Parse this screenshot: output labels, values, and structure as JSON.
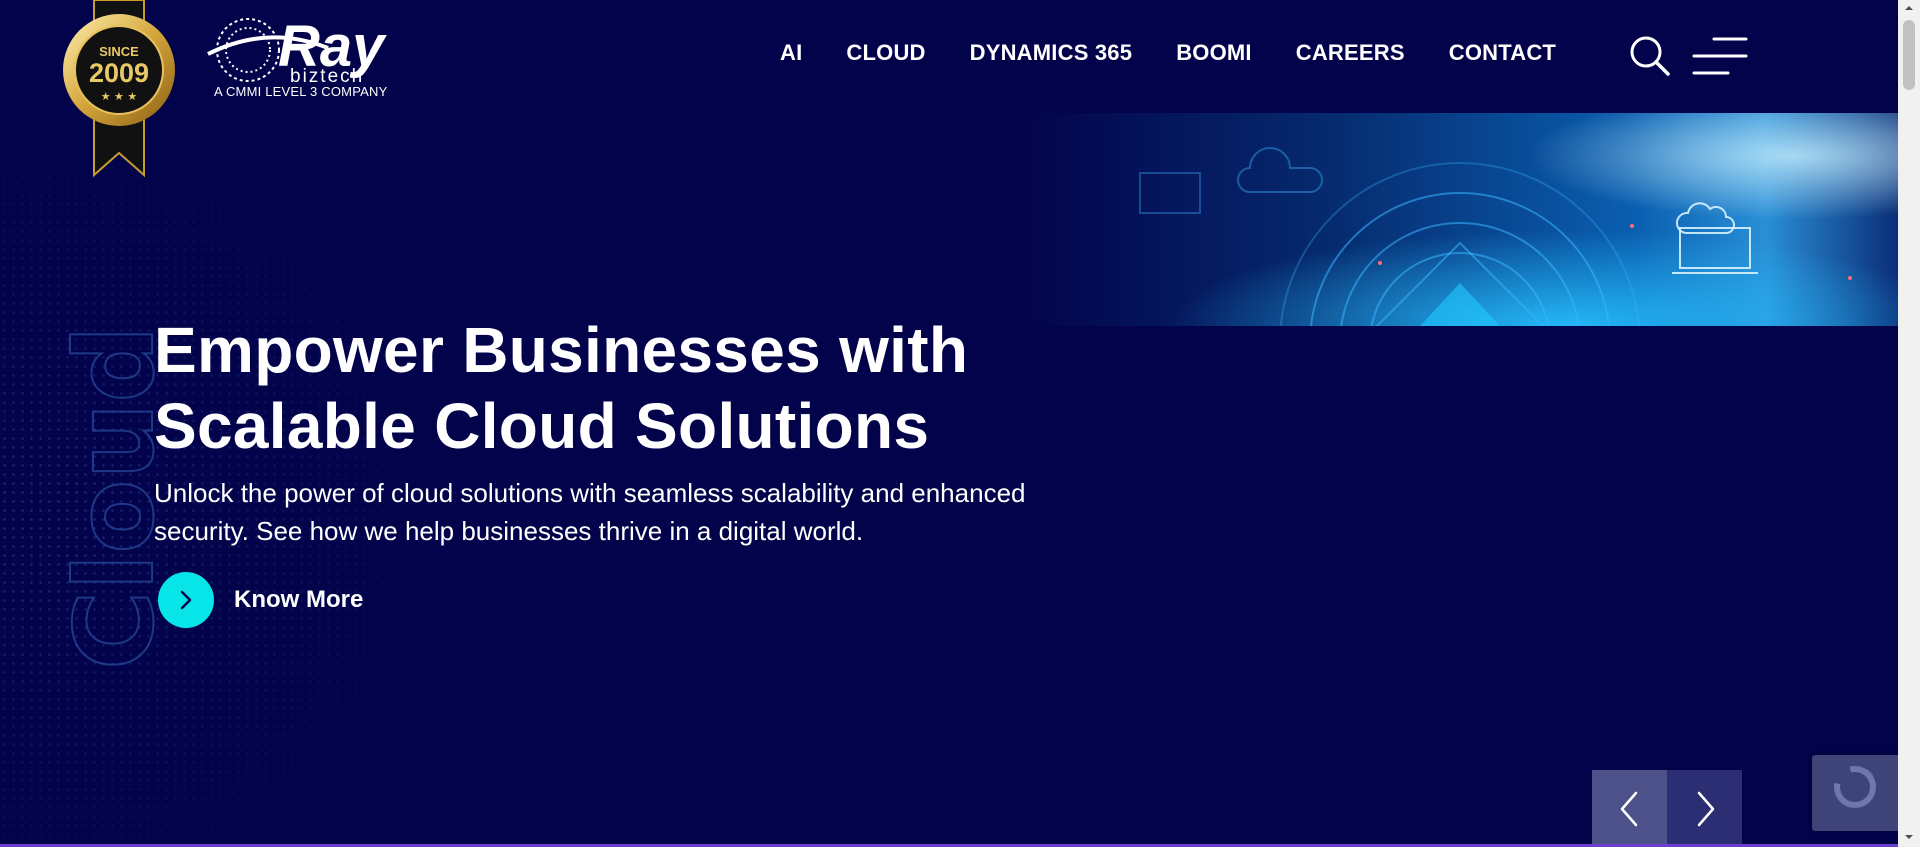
{
  "brand": {
    "badge_since": "SINCE",
    "badge_year": "2009",
    "logo_word": "Ray",
    "logo_sub": "biztech",
    "tagline": "A CMMI LEVEL 3 COMPANY"
  },
  "nav": {
    "items": [
      {
        "label": "AI"
      },
      {
        "label": "CLOUD"
      },
      {
        "label": "DYNAMICS 365"
      },
      {
        "label": "BOOMI"
      },
      {
        "label": "CAREERS"
      },
      {
        "label": "CONTACT"
      }
    ]
  },
  "hero": {
    "vertical_word": "Cloud",
    "title_line1": "Empower Businesses with",
    "title_line2": "Scalable Cloud Solutions",
    "subtitle_line1": "Unlock the power of cloud solutions with seamless scalability and enhanced",
    "subtitle_line2": "security. See how we help businesses thrive in a digital world.",
    "cta_label": "Know More"
  },
  "colors": {
    "background": "#03034b",
    "accent": "#07e5e8",
    "slider_prev": "#4d5189",
    "slider_next": "#2b2e72"
  },
  "icons": {
    "search": "search-icon",
    "menu": "hamburger-menu-icon",
    "cta": "chevron-right-icon",
    "prev": "chevron-left-icon",
    "next": "chevron-right-icon"
  }
}
